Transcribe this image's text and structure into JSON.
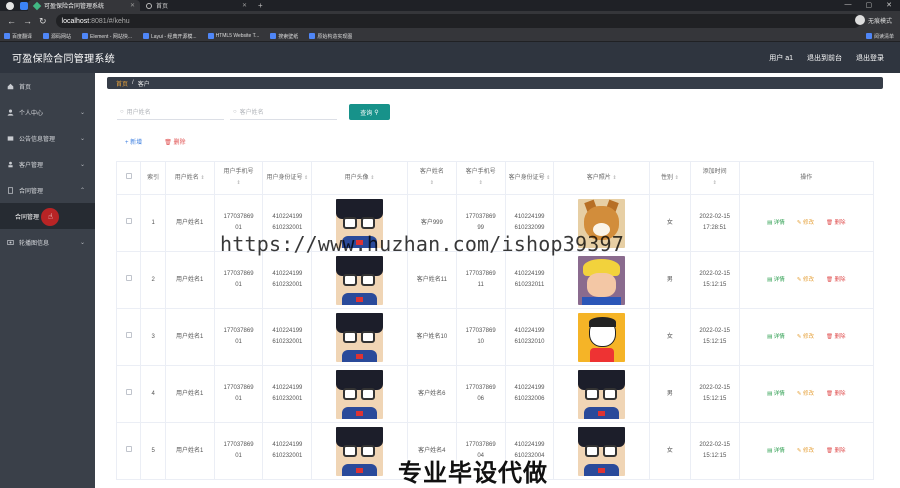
{
  "browser": {
    "tabs": [
      {
        "label": "可盈保险合同管理系统",
        "active": true
      },
      {
        "label": "首页",
        "active": false
      }
    ],
    "url_host": "localhost",
    "url_path": ":8081/#/kehu",
    "incognito_label": "无痕模式",
    "bookmarks": [
      "百度翻译",
      "源码网站",
      "Element - 网站快...",
      "Layui - 经典开源模...",
      "HTML5 Website T...",
      "搜索壁纸",
      "原始构造实现图"
    ],
    "bookmarks_right": "阅读清单"
  },
  "app": {
    "title": "可盈保险合同管理系统",
    "user_label": "用户 a1",
    "back_label": "退出到前台",
    "logout_label": "退出登录"
  },
  "sidebar": {
    "items": [
      {
        "label": "首页",
        "icon": "home-icon"
      },
      {
        "label": "个人中心",
        "icon": "user-icon"
      },
      {
        "label": "公告信息管理",
        "icon": "notice-icon"
      },
      {
        "label": "客户管理",
        "icon": "customer-icon"
      },
      {
        "label": "合同管理",
        "icon": "contract-icon"
      },
      {
        "label": "轮播图信息",
        "icon": "carousel-icon"
      }
    ],
    "sub_active": "合同管理"
  },
  "breadcrumb": {
    "first": "首页",
    "sep": "/",
    "current": "客户"
  },
  "search": {
    "field1_placeholder": "用户姓名",
    "field2_placeholder": "客户姓名",
    "button": "查询"
  },
  "toolbar": {
    "add": "新增",
    "delete": "删除"
  },
  "table": {
    "headers": {
      "index": "索引",
      "user_name": "用户姓名",
      "user_phone": "用户手机号",
      "user_id": "用户身份证号",
      "user_avatar": "用户头像",
      "cust_name": "客户姓名",
      "cust_phone": "客户手机号",
      "cust_id": "客户身份证号",
      "cust_photo": "客户照片",
      "gender": "性别",
      "added": "添加时间",
      "ops": "操作"
    },
    "op_labels": {
      "view": "详情",
      "edit": "修改",
      "delete": "删除"
    },
    "rows": [
      {
        "idx": "1",
        "user_name": "用户姓名1",
        "user_phone_a": "177037869",
        "user_phone_b": "01",
        "user_id_a": "410224199",
        "user_id_b": "610232001",
        "cust_name": "客户999",
        "cust_phone_a": "177037869",
        "cust_phone_b": "99",
        "cust_id_a": "410224199",
        "cust_id_b": "610232099",
        "photo": "dog",
        "gender": "女",
        "date": "2022-02-15",
        "time": "17:28:51"
      },
      {
        "idx": "2",
        "user_name": "用户姓名1",
        "user_phone_a": "177037869",
        "user_phone_b": "01",
        "user_id_a": "410224199",
        "user_id_b": "610232001",
        "cust_name": "客户姓名11",
        "cust_phone_a": "177037869",
        "cust_phone_b": "11",
        "cust_id_a": "410224199",
        "cust_id_b": "610232011",
        "photo": "cap",
        "gender": "男",
        "date": "2022-02-15",
        "time": "15:12:15"
      },
      {
        "idx": "3",
        "user_name": "用户姓名1",
        "user_phone_a": "177037869",
        "user_phone_b": "01",
        "user_id_a": "410224199",
        "user_id_b": "610232001",
        "cust_name": "客户姓名10",
        "cust_phone_a": "177037869",
        "cust_phone_b": "10",
        "cust_id_a": "410224199",
        "cust_id_b": "610232010",
        "photo": "shin",
        "gender": "女",
        "date": "2022-02-15",
        "time": "15:12:15"
      },
      {
        "idx": "4",
        "user_name": "用户姓名1",
        "user_phone_a": "177037869",
        "user_phone_b": "01",
        "user_id_a": "410224199",
        "user_id_b": "610232001",
        "cust_name": "客户姓名6",
        "cust_phone_a": "177037869",
        "cust_phone_b": "06",
        "cust_id_a": "410224199",
        "cust_id_b": "610232006",
        "photo": "conan",
        "gender": "男",
        "date": "2022-02-15",
        "time": "15:12:15"
      },
      {
        "idx": "5",
        "user_name": "用户姓名1",
        "user_phone_a": "177037869",
        "user_phone_b": "01",
        "user_id_a": "410224199",
        "user_id_b": "610232001",
        "cust_name": "客户姓名4",
        "cust_phone_a": "177037869",
        "cust_phone_b": "04",
        "cust_id_a": "410224199",
        "cust_id_b": "610232004",
        "photo": "conan",
        "gender": "女",
        "date": "2022-02-15",
        "time": "15:12:15"
      }
    ]
  },
  "overlay": {
    "watermark": "https://www.huzhan.com/ishop39397",
    "stamp": "专业毕设代做"
  },
  "colors": {
    "header_bg": "#2f353f",
    "sidebar_bg": "#3a4049",
    "primary_button": "#17928a",
    "view": "#2a9d4d",
    "edit": "#e6a23c",
    "delete": "#e05050"
  }
}
